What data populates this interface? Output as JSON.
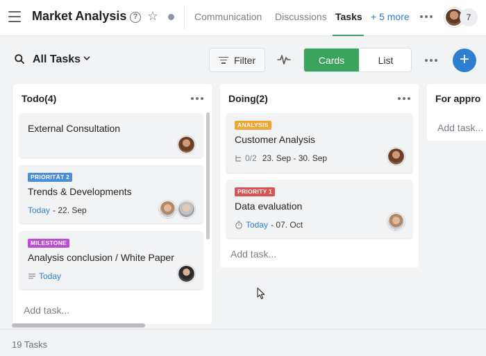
{
  "header": {
    "title": "Market Analysis",
    "help_icon": "?",
    "tabs": [
      {
        "label": "Communication",
        "active": false
      },
      {
        "label": "Discussions",
        "active": false
      },
      {
        "label": "Tasks",
        "active": true
      }
    ],
    "more_label": "+ 5 more",
    "member_count": "7"
  },
  "toolbar": {
    "view_title": "All Tasks",
    "filter_label": "Filter",
    "view_modes": [
      "Cards",
      "List"
    ],
    "active_view": "Cards",
    "add_icon": "+"
  },
  "columns": [
    {
      "title": "Todo(4)",
      "cards": [
        {
          "title": "External Consultation"
        },
        {
          "tag": "PRIORITÄT 2",
          "tag_color": "#4a8ed6",
          "title": "Trends & Developments",
          "date_start": "Today",
          "date_end": " - 22. Sep"
        },
        {
          "tag": "MILESTONE",
          "tag_color": "#b94fd0",
          "title": "Analysis conclusion / White Paper",
          "date_start": "Today"
        }
      ],
      "add_label": "Add task..."
    },
    {
      "title": "Doing(2)",
      "cards": [
        {
          "tag": "ANALYSIS",
          "tag_color": "#f0a533",
          "title": "Customer Analysis",
          "subtasks": "0/2",
          "dates": "23. Sep - 30. Sep"
        },
        {
          "tag": "PRIORITY 1",
          "tag_color": "#d55555",
          "title": "Data evaluation",
          "date_start": "Today",
          "date_end": " - 07. Oct"
        }
      ],
      "add_label": "Add task..."
    },
    {
      "title": "For appro",
      "add_label": "Add task..."
    }
  ],
  "footer": {
    "task_count": "19 Tasks"
  },
  "colors": {
    "accent_green": "#3aa35e",
    "accent_blue": "#2f7fd1"
  },
  "icons": [
    "menu-icon",
    "help-icon",
    "star-icon",
    "status-dot",
    "more-icon",
    "search-icon",
    "chevron-down-icon",
    "filter-icon",
    "activity-icon",
    "add-icon",
    "subtask-icon",
    "timer-icon",
    "description-icon"
  ]
}
